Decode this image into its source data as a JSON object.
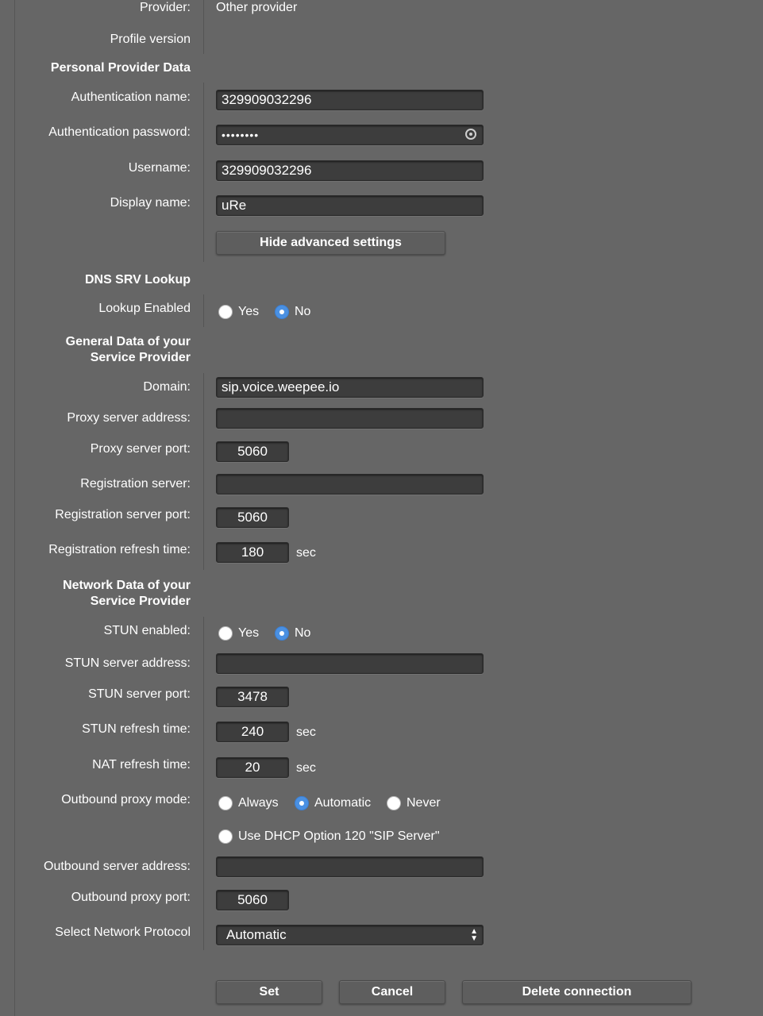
{
  "provider": {
    "label": "Provider:",
    "value": "Other provider"
  },
  "profile_version": {
    "label": "Profile version"
  },
  "personal_section": {
    "title": "Personal Provider Data",
    "auth_name": {
      "label": "Authentication name:",
      "value": "329909032296"
    },
    "auth_password": {
      "label": "Authentication password:",
      "value": "••••••••"
    },
    "username": {
      "label": "Username:",
      "value": "329909032296"
    },
    "display_name": {
      "label": "Display name:",
      "value": "uRe"
    },
    "hide_advanced_label": "Hide advanced settings"
  },
  "dns_section": {
    "title": "DNS SRV Lookup",
    "lookup": {
      "label": "Lookup Enabled",
      "yes": "Yes",
      "no": "No",
      "selected": "No"
    }
  },
  "general_section": {
    "title_line1": "General Data of your",
    "title_line2": "Service Provider",
    "domain": {
      "label": "Domain:",
      "value": "sip.voice.weepee.io"
    },
    "proxy_address": {
      "label": "Proxy server address:",
      "value": ""
    },
    "proxy_port": {
      "label": "Proxy server port:",
      "value": "5060"
    },
    "registration_server": {
      "label": "Registration server:",
      "value": ""
    },
    "registration_port": {
      "label": "Registration server port:",
      "value": "5060"
    },
    "registration_refresh": {
      "label": "Registration refresh time:",
      "value": "180",
      "unit": "sec"
    }
  },
  "network_section": {
    "title_line1": "Network Data of your",
    "title_line2": "Service Provider",
    "stun_enabled": {
      "label": "STUN enabled:",
      "yes": "Yes",
      "no": "No",
      "selected": "No"
    },
    "stun_address": {
      "label": "STUN server address:",
      "value": ""
    },
    "stun_port": {
      "label": "STUN server port:",
      "value": "3478"
    },
    "stun_refresh": {
      "label": "STUN refresh time:",
      "value": "240",
      "unit": "sec"
    },
    "nat_refresh": {
      "label": "NAT refresh time:",
      "value": "20",
      "unit": "sec"
    },
    "outbound_mode": {
      "label": "Outbound proxy mode:",
      "always": "Always",
      "automatic": "Automatic",
      "never": "Never",
      "dhcp": "Use DHCP Option 120 \"SIP Server\"",
      "selected": "Automatic"
    },
    "outbound_address": {
      "label": "Outbound server address:",
      "value": ""
    },
    "outbound_port": {
      "label": "Outbound proxy port:",
      "value": "5060"
    },
    "protocol": {
      "label": "Select Network Protocol",
      "value": "Automatic"
    }
  },
  "actions": {
    "set": "Set",
    "cancel": "Cancel",
    "delete": "Delete connection"
  },
  "colors": {
    "background": "#666666",
    "field": "#3d3d3d",
    "radio_selected": "#4a90e2"
  }
}
